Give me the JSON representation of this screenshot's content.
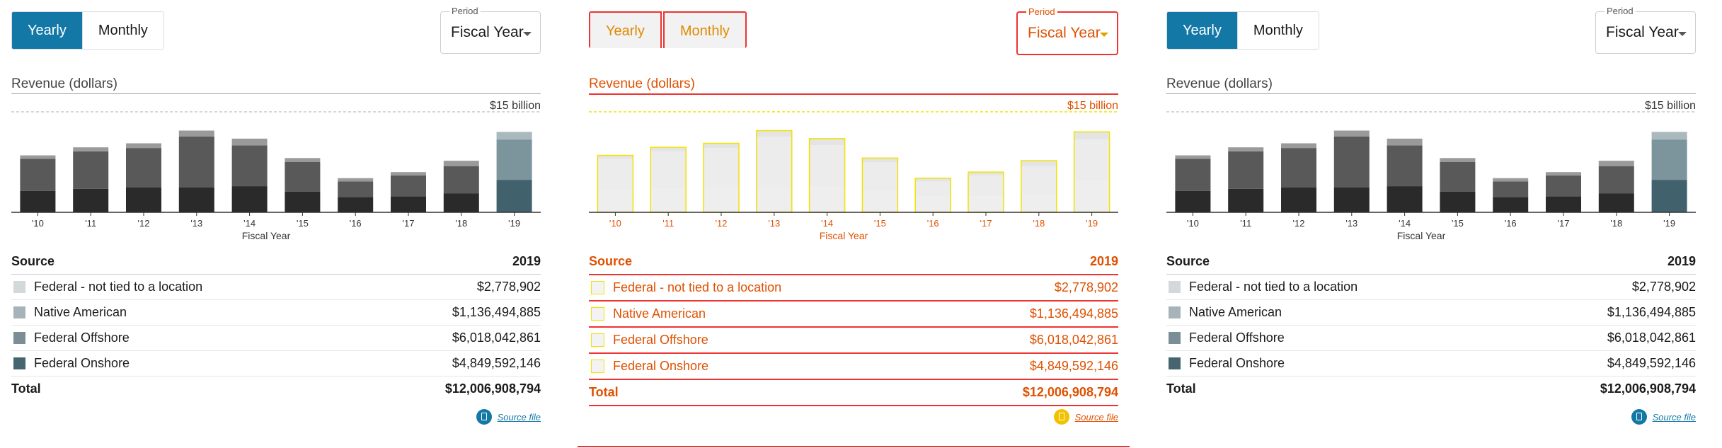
{
  "controls": {
    "yearly_label": "Yearly",
    "monthly_label": "Monthly",
    "period_label": "Period",
    "period_value": "Fiscal Year"
  },
  "table": {
    "header_source": "Source",
    "header_year": "2019",
    "rows": [
      {
        "label": "Federal - not tied to a location",
        "value": "$2,778,902"
      },
      {
        "label": "Native American",
        "value": "$1,136,494,885"
      },
      {
        "label": "Federal Offshore",
        "value": "$6,018,042,861"
      },
      {
        "label": "Federal Onshore",
        "value": "$4,849,592,146"
      }
    ],
    "total_label": "Total",
    "total_value": "$12,006,908,794"
  },
  "source_file_label": "Source file",
  "chart_data": {
    "type": "bar",
    "title": "Revenue (dollars)",
    "xlabel": "Fiscal Year",
    "ylabel": "",
    "max_label": "$15 billion",
    "ylim": [
      0,
      15000000000
    ],
    "stacked": true,
    "categories": [
      "'10",
      "'11",
      "'12",
      "'13",
      "'14",
      "'15",
      "'16",
      "'17",
      "'18",
      "'19"
    ],
    "series": [
      {
        "name": "Federal Onshore",
        "values": [
          3200000000,
          3500000000,
          3700000000,
          3700000000,
          3900000000,
          3100000000,
          2300000000,
          2400000000,
          2800000000,
          4849592146
        ]
      },
      {
        "name": "Federal Offshore",
        "values": [
          4800000000,
          5600000000,
          5900000000,
          7600000000,
          6100000000,
          4400000000,
          2300000000,
          3100000000,
          4100000000,
          6018042861
        ]
      },
      {
        "name": "Native American",
        "values": [
          500000000,
          600000000,
          700000000,
          900000000,
          1000000000,
          600000000,
          500000000,
          500000000,
          800000000,
          1136494885
        ]
      },
      {
        "name": "Federal - not tied to a location",
        "values": [
          0,
          0,
          0,
          0,
          0,
          0,
          0,
          0,
          0,
          2778902
        ]
      }
    ]
  },
  "colors": {
    "accent": "#1478a6",
    "onshore": "#2a2a2a",
    "offshore": "#595959",
    "native": "#9a9a9a",
    "fed_other": "#d7d7d7",
    "onshore_hl": "#41626d",
    "offshore_hl": "#7c949c",
    "native_hl": "#a9b9be",
    "fed_other_hl": "#d6dfe2",
    "swatch_onshore": "#47656f",
    "swatch_offshore": "#7b8e95",
    "swatch_native": "#a6b3b8",
    "swatch_fed_other": "#d3d8da"
  }
}
